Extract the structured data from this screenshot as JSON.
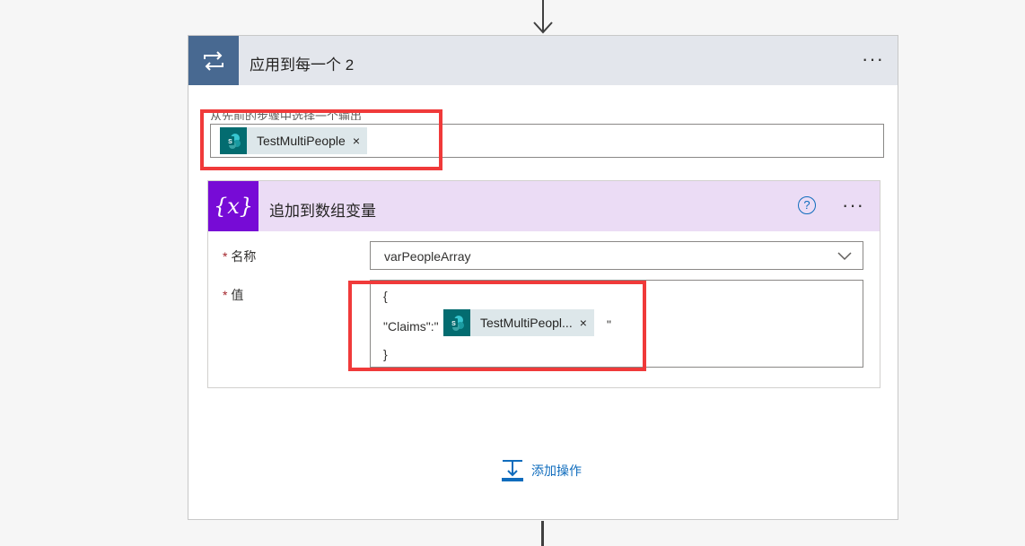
{
  "apply_each": {
    "title": "应用到每一个 2",
    "more_label": "···",
    "output_label": "从先前的步骤中选择一个输出",
    "token_label": "TestMultiPeople",
    "token_close": "×",
    "token_icon": "sharepoint-icon"
  },
  "append_action": {
    "title": "追加到数组变量",
    "icon_text": "{x}",
    "help_label": "?",
    "more_label": "···",
    "name_required": "*",
    "name_label": "名称",
    "name_value": "varPeopleArray",
    "value_required": "*",
    "value_label": "值",
    "value_line1": "{",
    "value_line2_prefix": "\"Claims\":\"",
    "value_token_label": "TestMultiPeopl...",
    "value_token_close": "×",
    "value_line2_suffix": "\"",
    "value_line3": "}"
  },
  "add_action": {
    "label": "添加操作"
  },
  "colors": {
    "loop_header": "#486991",
    "variable_header": "#770bd6",
    "sharepoint": "#036c70",
    "highlight": "#f03a3a",
    "link": "#0f6cbd"
  }
}
